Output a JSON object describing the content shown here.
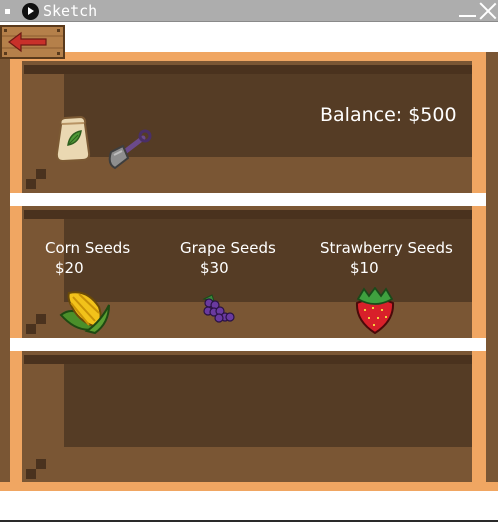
{
  "window": {
    "title": "Sketch",
    "menu_icon": "window-menu-icon",
    "app_icon": "play-circle-icon",
    "controls": [
      "minimize-icon",
      "close-icon"
    ]
  },
  "nav": {
    "back_icon": "back-arrow-icon"
  },
  "hud": {
    "balance": "Balance: $500",
    "inventory_icons": [
      "seed-bag-icon",
      "shovel-icon"
    ]
  },
  "shop": {
    "items": [
      {
        "name": "Corn Seeds",
        "price": "$20",
        "icon": "corn-icon"
      },
      {
        "name": "Grape Seeds",
        "price": "$30",
        "icon": "grape-icon"
      },
      {
        "name": "Strawberry Seeds",
        "price": "$10",
        "icon": "strawberry-icon"
      }
    ]
  },
  "colors": {
    "title_bar": "#adadad",
    "shelf_light": "#f0a662",
    "shelf_mid": "#7a5634",
    "shelf_dark": "#553c25",
    "back_arrow": "#c8302a"
  }
}
